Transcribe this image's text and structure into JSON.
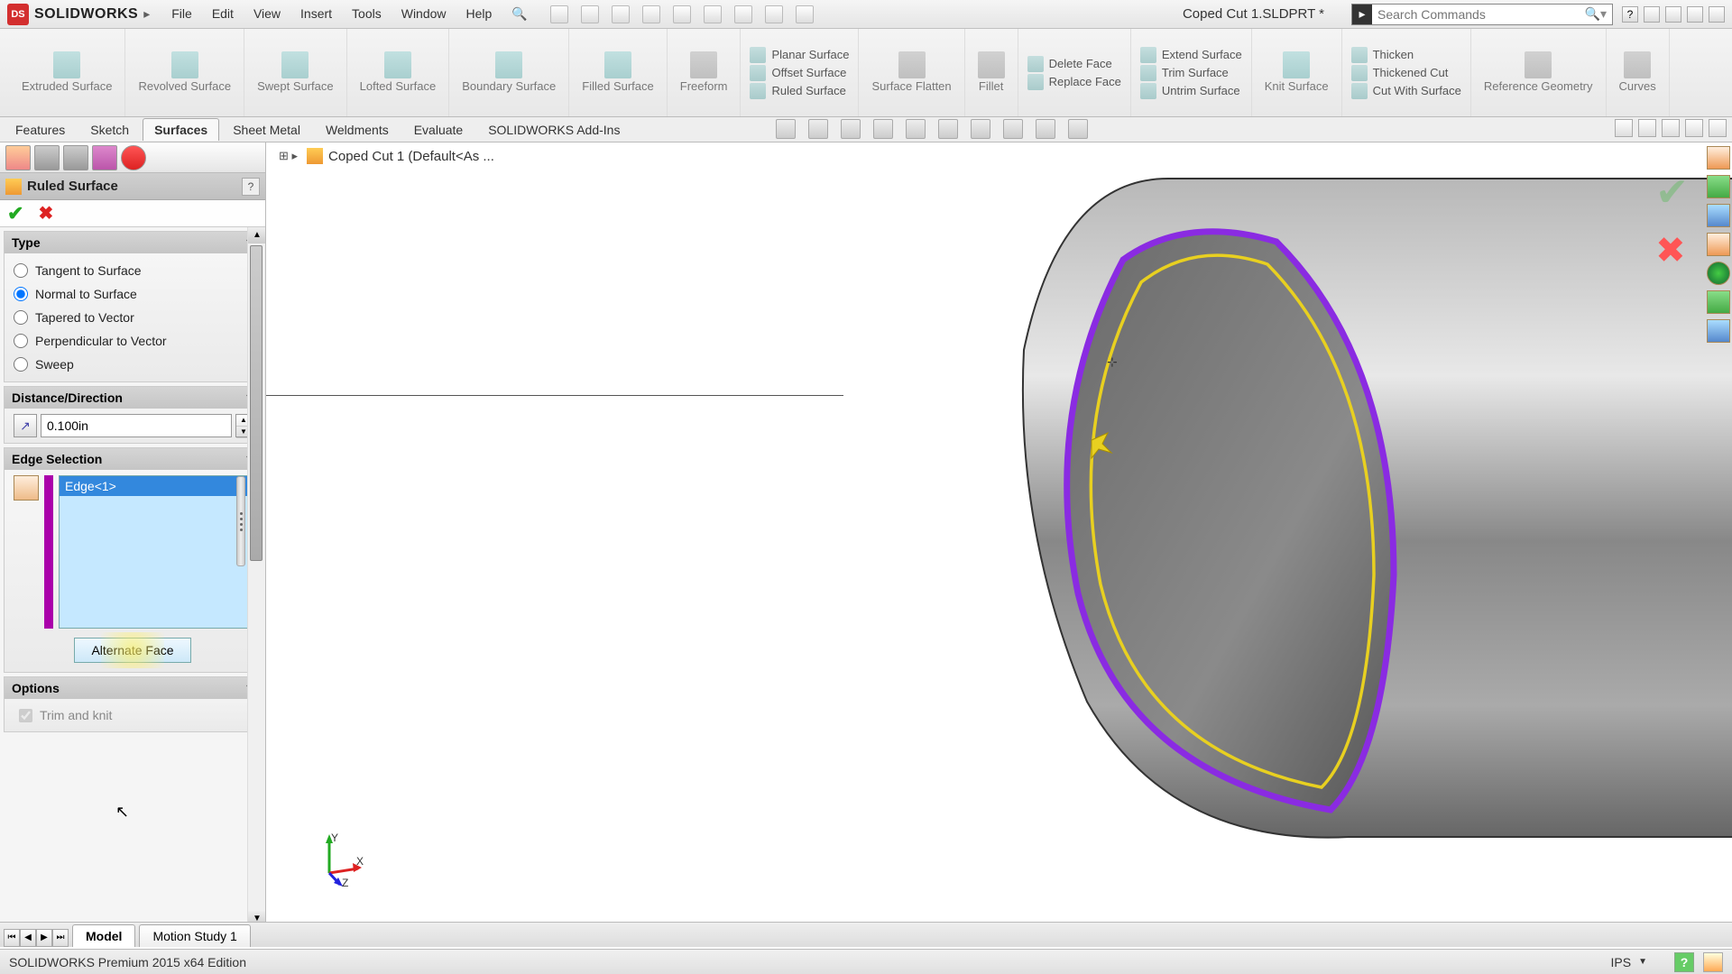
{
  "app": {
    "name": "SOLIDWORKS",
    "doc_title": "Coped Cut 1.SLDPRT *"
  },
  "menu": [
    "File",
    "Edit",
    "View",
    "Insert",
    "Tools",
    "Window",
    "Help"
  ],
  "search": {
    "placeholder": "Search Commands"
  },
  "ribbon": {
    "big": [
      {
        "label": "Extruded Surface"
      },
      {
        "label": "Revolved Surface"
      },
      {
        "label": "Swept Surface"
      },
      {
        "label": "Lofted Surface"
      },
      {
        "label": "Boundary Surface"
      },
      {
        "label": "Filled Surface"
      },
      {
        "label": "Freeform"
      }
    ],
    "col1": [
      "Planar Surface",
      "Offset Surface",
      "Ruled Surface"
    ],
    "mid": [
      {
        "label": "Surface Flatten"
      },
      {
        "label": "Fillet"
      }
    ],
    "col2": [
      "Delete Face",
      "Replace Face"
    ],
    "col3": [
      "Extend Surface",
      "Trim Surface",
      "Untrim Surface"
    ],
    "knit": {
      "label": "Knit Surface"
    },
    "col4": [
      "Thicken",
      "Thickened Cut",
      "Cut With Surface"
    ],
    "right": [
      {
        "label": "Reference Geometry"
      },
      {
        "label": "Curves"
      }
    ]
  },
  "feature_tabs": [
    "Features",
    "Sketch",
    "Surfaces",
    "Sheet Metal",
    "Weldments",
    "Evaluate",
    "SOLIDWORKS Add-Ins"
  ],
  "feature_tabs_active": "Surfaces",
  "breadcrumb": "Coped Cut 1  (Default<As ...",
  "pm": {
    "title": "Ruled Surface",
    "sections": {
      "type": {
        "title": "Type",
        "options": [
          "Tangent to Surface",
          "Normal to Surface",
          "Tapered to Vector",
          "Perpendicular to Vector",
          "Sweep"
        ],
        "selected": "Normal to Surface"
      },
      "distance": {
        "title": "Distance/Direction",
        "value": "0.100in"
      },
      "edge": {
        "title": "Edge Selection",
        "items": [
          "Edge<1>"
        ],
        "button": "Alternate Face"
      },
      "options": {
        "title": "Options",
        "trim_knit": "Trim and knit"
      }
    }
  },
  "bottom_tabs": [
    "Model",
    "Motion Study 1"
  ],
  "bottom_tabs_active": "Model",
  "status": {
    "text": "SOLIDWORKS Premium 2015 x64 Edition",
    "units": "IPS"
  }
}
